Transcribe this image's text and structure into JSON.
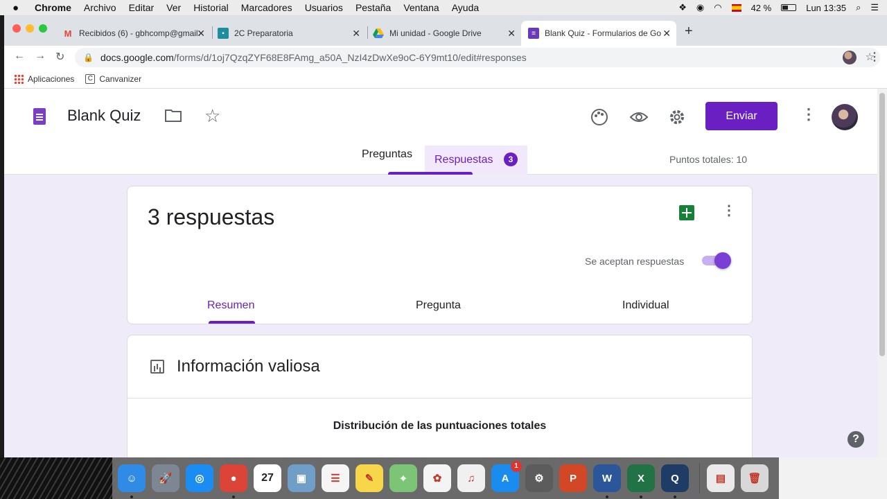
{
  "menubar": {
    "apple": "",
    "items": [
      "Chrome",
      "Archivo",
      "Editar",
      "Ver",
      "Historial",
      "Marcadores",
      "Usuarios",
      "Pestaña",
      "Ventana",
      "Ayuda"
    ],
    "battery": "42 %",
    "clock": "Lun 13:35"
  },
  "browser": {
    "tabs": [
      {
        "title": "Recibidos (6) - gbhcomp@gmail.",
        "icon": "gmail-icon",
        "color": "#ea4335"
      },
      {
        "title": "2C Preparatoria",
        "icon": "classroom-icon",
        "color": "#1e8e9e"
      },
      {
        "title": "Mi unidad - Google Drive",
        "icon": "drive-icon",
        "color": "#fbbc04"
      },
      {
        "title": "Blank Quiz - Formularios de Go",
        "icon": "forms-icon",
        "color": "#673ab7"
      }
    ],
    "url_host": "docs.google.com",
    "url_path": "/forms/d/1oj7QzqZYF68E8FAmg_a50A_NzI4zDwXe9oC-6Y9mt10/edit#responses",
    "bookmarks": [
      "Aplicaciones",
      "Canvanizer"
    ]
  },
  "form": {
    "title": "Blank Quiz",
    "send_label": "Enviar",
    "tabs": {
      "questions": "Preguntas",
      "responses": "Respuestas",
      "responses_count": "3"
    },
    "total_points": "Puntos totales: 10",
    "responses_card": {
      "count_label": "3 respuestas",
      "accepting_label": "Se aceptan respuestas",
      "accepting": true,
      "sub_tabs": [
        "Resumen",
        "Pregunta",
        "Individual"
      ]
    },
    "insights_card": {
      "title": "Información valiosa",
      "distribution_title": "Distribución de las puntuaciones totales"
    },
    "help": "?"
  },
  "dock": {
    "apps": [
      {
        "name": "finder",
        "color": "#2f8be6",
        "glyph": "☺"
      },
      {
        "name": "launchpad",
        "color": "#7d8794",
        "glyph": "🚀"
      },
      {
        "name": "safari",
        "color": "#1b8df2",
        "glyph": "◎"
      },
      {
        "name": "chrome",
        "color": "#db4437",
        "glyph": "●"
      },
      {
        "name": "calendar",
        "color": "#ffffff",
        "glyph": "27"
      },
      {
        "name": "preview",
        "color": "#6f9fc9",
        "glyph": "▣"
      },
      {
        "name": "reminders",
        "color": "#f5f5f5",
        "glyph": "☰"
      },
      {
        "name": "notes",
        "color": "#f7d64a",
        "glyph": "✎"
      },
      {
        "name": "maps",
        "color": "#7cc576",
        "glyph": "⌖"
      },
      {
        "name": "photos",
        "color": "#f4f4f4",
        "glyph": "✿"
      },
      {
        "name": "itunes",
        "color": "#f0f0f0",
        "glyph": "♫"
      },
      {
        "name": "app-store",
        "color": "#1a8cf0",
        "glyph": "A",
        "badge": "1"
      },
      {
        "name": "system-preferences",
        "color": "#5c5c5c",
        "glyph": "⚙"
      },
      {
        "name": "powerpoint",
        "color": "#d24726",
        "glyph": "P"
      },
      {
        "name": "word",
        "color": "#2b579a",
        "glyph": "W"
      },
      {
        "name": "excel",
        "color": "#217346",
        "glyph": "X"
      },
      {
        "name": "quicktime",
        "color": "#1e3c66",
        "glyph": "Q"
      }
    ],
    "extras": [
      {
        "name": "downloads-stack",
        "color": "#eaeaea",
        "glyph": "▤"
      },
      {
        "name": "trash",
        "color": "#d8d8d8",
        "glyph": "🗑"
      }
    ]
  }
}
